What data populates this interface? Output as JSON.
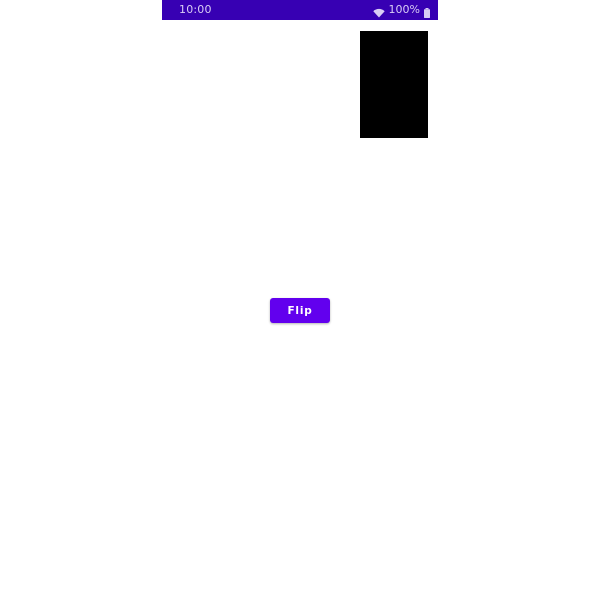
{
  "status_bar": {
    "time": "10:00",
    "battery_text": "100%",
    "background_color": "#3700b3",
    "icons": [
      "wifi-icon",
      "battery-icon"
    ]
  },
  "main": {
    "card": {
      "color": "#000000"
    },
    "flip_button": {
      "label": "Flip",
      "color": "#6200ee"
    }
  }
}
